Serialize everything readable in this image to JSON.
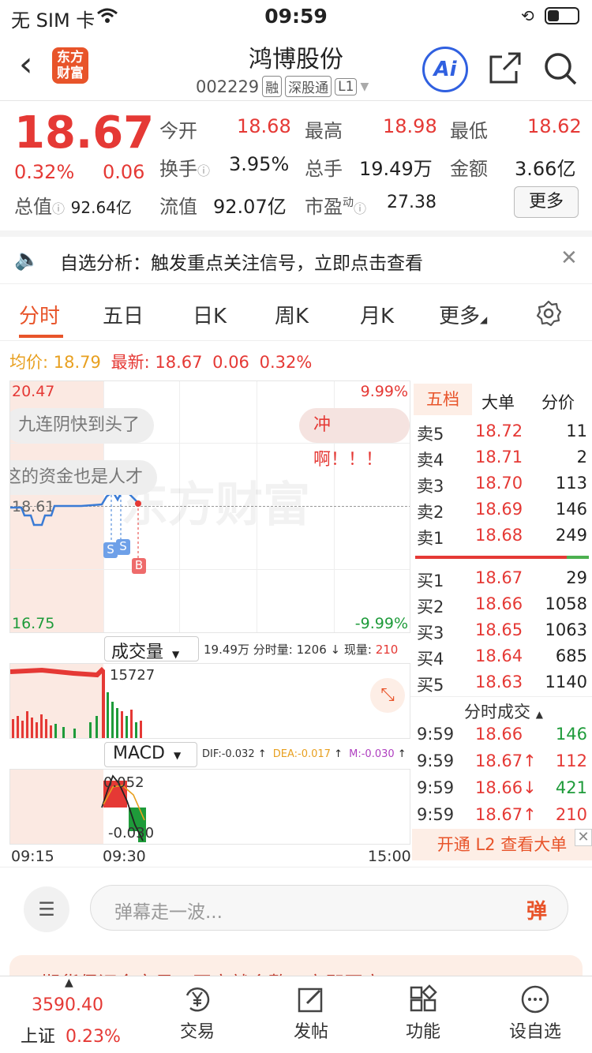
{
  "status": {
    "carrier": "无 SIM 卡",
    "time": "09:59"
  },
  "header": {
    "logo_line1": "东方",
    "logo_line2": "财富",
    "name": "鸿博股份",
    "code": "002229",
    "tags": [
      "融",
      "深股通",
      "L1"
    ],
    "ai": "Ai"
  },
  "quote": {
    "price": "18.67",
    "pct": "0.32%",
    "chg": "0.06",
    "open_label": "今开",
    "open": "18.68",
    "high_label": "最高",
    "high": "18.98",
    "low_label": "最低",
    "low": "18.62",
    "turnover_label": "换手",
    "turnover": "3.95%",
    "volume_label": "总手",
    "volume": "19.49万",
    "amount_label": "金额",
    "amount": "3.66亿",
    "mktcap_label": "总值",
    "mktcap": "92.64亿",
    "float_label": "流值",
    "float": "92.07亿",
    "pe_label": "市盈",
    "pe_sup": "动",
    "pe": "27.38",
    "more": "更多"
  },
  "notice": {
    "text": "自选分析：触发重点关注信号，立即点击查看"
  },
  "tabs": [
    "分时",
    "五日",
    "日K",
    "周K",
    "月K",
    "更多"
  ],
  "avgbar": {
    "avg_label": "均价:",
    "avg": "18.79",
    "last_label": "最新:",
    "last": "18.67",
    "chg": "0.06",
    "pct": "0.32%"
  },
  "chart": {
    "top_price": "20.47",
    "bottom_price": "16.75",
    "ref_price": "18.61",
    "top_pct": "9.99%",
    "bottom_pct": "-9.99%",
    "watermark": "东方财富",
    "danmu": [
      "九连阴快到头了",
      "冲啊！！！",
      "这的资金也是人才"
    ],
    "markers": [
      "S",
      "S",
      "B"
    ]
  },
  "volume": {
    "label": "成交量",
    "total": "19.49万",
    "fen_label": "分时量:",
    "fen": "1206",
    "now_label": "现量:",
    "now": "210",
    "peak": "15727"
  },
  "macd": {
    "label": "MACD",
    "dif": "DIF:-0.032",
    "dea": "DEA:-0.017",
    "m": "M:-0.030",
    "top": "0.052",
    "bottom": "-0.030"
  },
  "time_axis": [
    "09:15",
    "09:30",
    "15:00"
  ],
  "orderbook": {
    "tabs": [
      "五档",
      "大单",
      "分价"
    ],
    "asks": [
      {
        "l": "卖5",
        "p": "18.72",
        "v": "11"
      },
      {
        "l": "卖4",
        "p": "18.71",
        "v": "2"
      },
      {
        "l": "卖3",
        "p": "18.70",
        "v": "113"
      },
      {
        "l": "卖2",
        "p": "18.69",
        "v": "146"
      },
      {
        "l": "卖1",
        "p": "18.68",
        "v": "249"
      }
    ],
    "bids": [
      {
        "l": "买1",
        "p": "18.67",
        "v": "29"
      },
      {
        "l": "买2",
        "p": "18.66",
        "v": "1058"
      },
      {
        "l": "买3",
        "p": "18.65",
        "v": "1063"
      },
      {
        "l": "买4",
        "p": "18.64",
        "v": "685"
      },
      {
        "l": "买5",
        "p": "18.63",
        "v": "1140"
      }
    ],
    "ticks_label": "分时成交",
    "ticks": [
      {
        "t": "9:59",
        "p": "18.66",
        "v": "146",
        "dir": ""
      },
      {
        "t": "9:59",
        "p": "18.67↑",
        "v": "112",
        "dir": "up"
      },
      {
        "t": "9:59",
        "p": "18.66↓",
        "v": "421",
        "dir": "down"
      },
      {
        "t": "9:59",
        "p": "18.67↑",
        "v": "210",
        "dir": "up"
      }
    ],
    "l2": "开通 L2 查看大单"
  },
  "danmu_bar": {
    "placeholder": "弹幕走一波...",
    "btn": "弹"
  },
  "ad": {
    "text": "期货保证金交易，开户就会整，立即开户"
  },
  "nav": {
    "index_value": "3590.40",
    "index_name": "上证",
    "index_pct": "0.23%",
    "items": [
      "交易",
      "发帖",
      "功能",
      "设自选"
    ]
  },
  "colors": {
    "up": "#e53935",
    "down": "#1e9b3a",
    "accent": "#e8542a",
    "ai": "#3060e0"
  }
}
